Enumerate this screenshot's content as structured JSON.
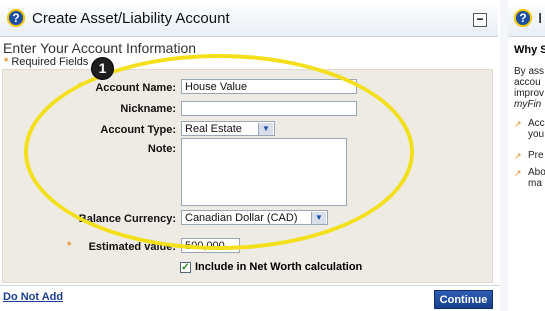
{
  "panel": {
    "title": "Create Asset/Liability Account",
    "collapse_symbol": "−",
    "section_title": "Enter Your Account Information",
    "required_note": "Required Fields",
    "required_star": "*"
  },
  "form": {
    "account_name_label": "Account Name:",
    "account_name_value": "House Value",
    "nickname_label": "Nickname:",
    "nickname_value": "",
    "account_type_label": "Account Type:",
    "account_type_value": "Real Estate",
    "note_label": "Note:",
    "note_value": "",
    "balance_currency_label": "Balance Currency:",
    "balance_currency_value": "Canadian Dollar (CAD)",
    "estimated_value_label": "Estimated value:",
    "estimated_value_value": "500,000",
    "include_networth_label": "Include in Net Worth calculation",
    "include_networth_checked": true
  },
  "footer": {
    "do_not_add": "Do Not Add",
    "continue": "Continue"
  },
  "callout": {
    "number": "1"
  },
  "right_panel": {
    "title": "I",
    "subtitle": "Why S",
    "body_lines": [
      "By ass",
      "accou",
      "improv",
      "myFin"
    ],
    "items": [
      "Acc you",
      "Pre",
      "Abo ma"
    ]
  },
  "colors": {
    "accent_blue": "#1c4ea1",
    "highlight_yellow": "#f3e01a",
    "required_star": "#e89a2b",
    "form_bg": "#eeeae4"
  },
  "icons": [
    "help-icon",
    "collapse-icon",
    "dropdown-arrow-icon",
    "checkmark-icon",
    "arrow-bullet-icon"
  ]
}
